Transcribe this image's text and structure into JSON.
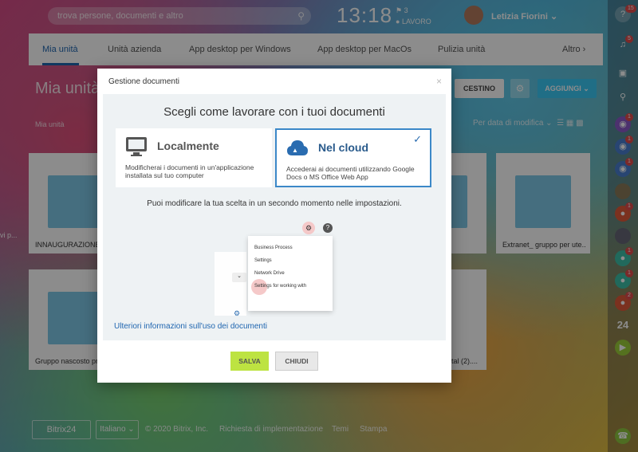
{
  "topbar": {
    "search_placeholder": "trova persone, documenti e altro",
    "time": "13:18",
    "flag_count": "3",
    "work_status": "LAVORO",
    "user_name": "Letizia Fiorini"
  },
  "tabs": [
    "Mia unità",
    "Unità azienda",
    "App desktop per Windows",
    "App desktop per MacOs",
    "Pulizia unità",
    "Altro"
  ],
  "page": {
    "title": "Mia unità",
    "breadcrumb": "Mia unità",
    "trash_label": "CESTINO",
    "add_label": "AGGIUNGI",
    "sort_label": "Per data di modifica",
    "left_clip": "vi p..."
  },
  "files": [
    {
      "label": "INNAUGURAZIONE"
    },
    {
      "label": "Extranet_ gruppo per ute..."
    },
    {
      "label": "Gruppo nascosto pr"
    },
    {
      "label": "ital (2)...."
    }
  ],
  "modal": {
    "title": "Gestione documenti",
    "heading": "Scegli come lavorare con i tuoi documenti",
    "option_local_title": "Localmente",
    "option_local_desc": "Modificherai i documenti in un'applicazione installata sul tuo computer",
    "option_cloud_title": "Nel cloud",
    "option_cloud_desc": "Accederai ai documenti utilizzando Google Docs o MS Office Web App",
    "note": "Puoi modificare la tua scelta in un secondo momento nelle impostazioni.",
    "menu_items": [
      "Business Process",
      "Settings",
      "Network Drive",
      "Settings for working with"
    ],
    "more_link": "Ulteriori informazioni sull'uso dei documenti",
    "save_label": "SALVA",
    "close_label": "CHIUDI"
  },
  "footer": {
    "brand": "Bitrix24",
    "language": "Italiano",
    "copyright": "© 2020 Bitrix, Inc.",
    "impl": "Richiesta di implementazione",
    "themes": "Temi",
    "print": "Stampa"
  },
  "rightbar": {
    "badges": [
      "15",
      "5",
      "1",
      "1",
      "1",
      "1",
      "1",
      "1",
      "2"
    ],
    "counter": "24"
  }
}
